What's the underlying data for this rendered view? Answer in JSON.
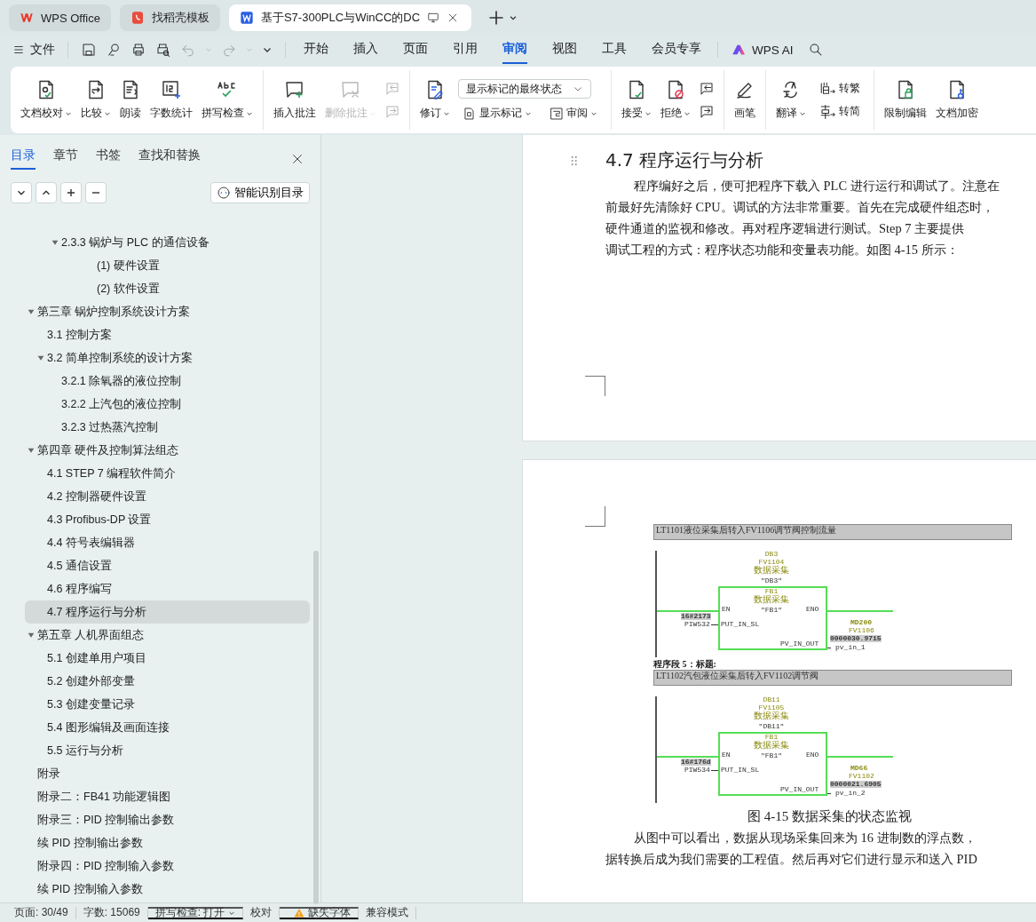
{
  "browser_tabs": [
    {
      "label": "WPS Office",
      "selected": false
    },
    {
      "label": "找稻壳模板",
      "selected": false
    },
    {
      "label": "基于S7-300PLC与WinCC的DC",
      "selected": true
    }
  ],
  "menu": {
    "file": "文件",
    "quick_actions": [
      {
        "disabled": false
      },
      {
        "disabled": false
      },
      {
        "disabled": false
      },
      {
        "disabled": false
      },
      {
        "disabled": true
      },
      {
        "disabled": true
      }
    ],
    "tabs": [
      {
        "label": "开始",
        "selected": false
      },
      {
        "label": "插入",
        "selected": false
      },
      {
        "label": "页面",
        "selected": false
      },
      {
        "label": "引用",
        "selected": false
      },
      {
        "label": "审阅",
        "selected": true
      },
      {
        "label": "视图",
        "selected": false
      },
      {
        "label": "工具",
        "selected": false
      },
      {
        "label": "会员专享",
        "selected": false
      }
    ],
    "ai": "WPS AI"
  },
  "ribbon": [
    {
      "items": [
        {
          "kind": "big",
          "label": "文档校对",
          "caret": true,
          "disabled": false
        },
        {
          "kind": "big",
          "label": "比较",
          "caret": true,
          "disabled": false
        },
        {
          "kind": "big",
          "label": "朗读",
          "caret": false,
          "disabled": false
        },
        {
          "kind": "big",
          "label": "字数统计",
          "caret": false,
          "disabled": false
        },
        {
          "kind": "big",
          "label": "拼写检查",
          "caret": true,
          "disabled": false
        }
      ]
    },
    {
      "items": [
        {
          "kind": "big",
          "label": "插入批注",
          "caret": false,
          "disabled": false
        },
        {
          "kind": "big",
          "label": "删除批注",
          "caret": true,
          "disabled": true
        },
        {
          "kind": "icons",
          "icons": [
            {
              "disabled": true
            },
            {
              "disabled": true
            }
          ]
        }
      ]
    },
    {
      "items": [
        {
          "kind": "big",
          "label": "修订",
          "caret": true,
          "disabled": false
        },
        {
          "kind": "markup",
          "value": "显示标记的最终状态",
          "options": [
            {
              "label": "显示标记",
              "caret": true
            },
            {
              "label": "审阅",
              "caret": true
            }
          ]
        }
      ]
    },
    {
      "items": [
        {
          "kind": "big",
          "label": "接受",
          "caret": true,
          "disabled": false
        },
        {
          "kind": "big",
          "label": "拒绝",
          "caret": true,
          "disabled": false
        },
        {
          "kind": "icons",
          "icons": [
            {
              "disabled": false
            },
            {
              "disabled": false
            }
          ]
        }
      ]
    },
    {
      "items": [
        {
          "kind": "big",
          "label": "画笔",
          "caret": false,
          "disabled": false
        }
      ]
    },
    {
      "items": [
        {
          "kind": "big",
          "label": "翻译",
          "caret": true,
          "disabled": false
        },
        {
          "kind": "small",
          "entries": [
            {
              "label": "转繁"
            },
            {
              "label": "转简"
            }
          ]
        }
      ]
    },
    {
      "items": [
        {
          "kind": "big",
          "label": "限制编辑",
          "caret": false,
          "disabled": false
        },
        {
          "kind": "big",
          "label": "文档加密",
          "caret": false,
          "disabled": false
        }
      ]
    }
  ],
  "sidebar": {
    "tabs": [
      {
        "label": "目录",
        "selected": true
      },
      {
        "label": "章节",
        "selected": false
      },
      {
        "label": "书签",
        "selected": false
      },
      {
        "label": "查找和替换",
        "selected": false
      }
    ],
    "smart_button": "智能识别目录",
    "toc_continued": [
      {
        "label": "2.3.3  锅炉与 PLC 的通信设备",
        "expanded": true,
        "selected": false,
        "children": [
          {
            "label": "(1)  硬件设置",
            "selected": false
          },
          {
            "label": "(2)  软件设置",
            "selected": false
          }
        ]
      }
    ],
    "toc": [
      {
        "label": "第三章  锅炉控制系统设计方案",
        "expanded": true,
        "selected": false,
        "children": [
          {
            "label": "3.1  控制方案",
            "selected": false
          },
          {
            "label": "3.2  简单控制系统的设计方案",
            "expanded": true,
            "selected": false,
            "children": [
              {
                "label": "3.2.1  除氧器的液位控制",
                "selected": false
              },
              {
                "label": "3.2.2 上汽包的液位控制",
                "selected": false
              },
              {
                "label": "3.2.3  过热蒸汽控制",
                "selected": false
              }
            ]
          }
        ]
      },
      {
        "label": "第四章  硬件及控制算法组态",
        "expanded": true,
        "selected": false,
        "children": [
          {
            "label": "4.1 STEP 7  编程软件简介",
            "selected": false
          },
          {
            "label": "4.2  控制器硬件设置",
            "selected": false
          },
          {
            "label": "4.3 Profibus-DP 设置",
            "selected": false
          },
          {
            "label": "4.4  符号表编辑器",
            "selected": false
          },
          {
            "label": "4.5  通信设置",
            "selected": false
          },
          {
            "label": "4.6  程序编写",
            "selected": false
          },
          {
            "label": "4.7  程序运行与分析",
            "selected": true
          }
        ]
      },
      {
        "label": "第五章  人机界面组态",
        "expanded": true,
        "selected": false,
        "children": [
          {
            "label": "5.1 创建单用户项目",
            "selected": false
          },
          {
            "label": "5.2  创建外部变量",
            "selected": false
          },
          {
            "label": "5.3 创建变量记录",
            "selected": false
          },
          {
            "label": "5.4  图形编辑及画面连接",
            "selected": false
          },
          {
            "label": "5.5  运行与分析",
            "selected": false
          }
        ]
      },
      {
        "label": "附录",
        "selected": false
      },
      {
        "label": "附录二：FB41 功能逻辑图",
        "selected": false
      },
      {
        "label": "附录三：PID 控制输出参数",
        "selected": false
      },
      {
        "label": "续 PID 控制输出参数",
        "selected": false
      },
      {
        "label": "附录四：PID 控制输入参数",
        "selected": false
      },
      {
        "label": "续 PID 控制输入参数",
        "selected": false
      }
    ]
  },
  "document": {
    "heading": "4.7  程序运行与分析",
    "paragraph_lines": [
      "程序编好之后，便可把程序下载入 PLC 进行运行和调试了。注意在",
      "前最好先清除好 CPU。调试的方法非常重要。首先在完成硬件组态时，",
      "硬件通道的监视和修改。再对程序逻辑进行测试。Step 7 主要提供",
      "调试工程的方式：程序状态功能和变量表功能。如图 4-15 所示："
    ],
    "figure": {
      "networks": [
        {
          "title": "LT1101液位采集后转入FV1106调节阀控制流量",
          "instance": [
            "DB3",
            "FV1104",
            "数据采集",
            "\"DB3\""
          ],
          "block": [
            "FB1",
            "数据采集",
            "\"FB1\""
          ],
          "en": "EN",
          "eno": "ENO",
          "input_value": "16#2173",
          "input_address": "PIW532",
          "input_pin": "PUT_IN_SL",
          "output_pin": "PV_IN_OUT",
          "output_address": "MD200",
          "output_symbol": "FV1106",
          "output_value": "0000030.9715",
          "output_operand": "pv_in_1"
        },
        {
          "label": "程序段 5：标题:",
          "title": "LT1102汽包液位采集后转入FV1102调节阀",
          "instance": [
            "DB11",
            "FV1105",
            "数据采集",
            "\"DB11\""
          ],
          "block": [
            "FB1",
            "数据采集",
            "\"FB1\""
          ],
          "en": "EN",
          "eno": "ENO",
          "input_value": "16#176d",
          "input_address": "PIW534",
          "input_pin": "PUT_IN_SL",
          "output_pin": "PV_IN_OUT",
          "output_address": "MD66",
          "output_symbol": "FV1102",
          "output_value": "0000021.6905",
          "output_operand": "pv_in_2"
        }
      ],
      "caption": "图 4-15 数据采集的状态监视"
    },
    "after_lines": [
      "从图中可以看出，数据从现场采集回来为 16 进制数的浮点数，",
      "据转换后成为我们需要的工程值。然后再对它们进行显示和送入 PID"
    ]
  },
  "status_bar": [
    {
      "kind": "text",
      "label": "页面: 30/49"
    },
    {
      "kind": "text",
      "label": "字数: 15069"
    },
    {
      "kind": "menu",
      "label": "拼写检查: 打开"
    },
    {
      "kind": "text",
      "label": "校对"
    },
    {
      "kind": "warning",
      "label": "缺失字体"
    },
    {
      "kind": "text",
      "label": "兼容模式"
    }
  ]
}
